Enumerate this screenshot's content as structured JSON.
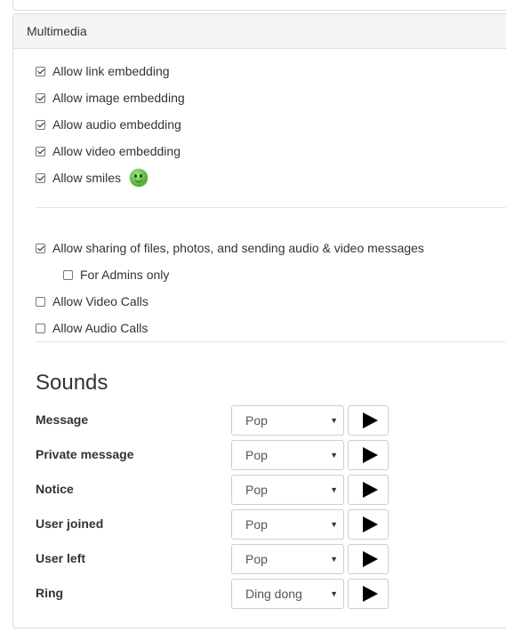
{
  "panel": {
    "title": "Multimedia"
  },
  "embedding": [
    {
      "label": "Allow link embedding",
      "checked": true
    },
    {
      "label": "Allow image embedding",
      "checked": true
    },
    {
      "label": "Allow audio embedding",
      "checked": true
    },
    {
      "label": "Allow video embedding",
      "checked": true
    },
    {
      "label": "Allow smiles",
      "checked": true,
      "icon": "smile-icon"
    }
  ],
  "sharing": [
    {
      "label": "Allow sharing of files, photos, and sending audio & video messages",
      "checked": true
    },
    {
      "label": "For Admins only",
      "checked": false
    },
    {
      "label": "Allow Video Calls",
      "checked": false
    },
    {
      "label": "Allow Audio Calls",
      "checked": false
    }
  ],
  "sounds": {
    "title": "Sounds",
    "rows": [
      {
        "label": "Message",
        "value": "Pop"
      },
      {
        "label": "Private message",
        "value": "Pop"
      },
      {
        "label": "Notice",
        "value": "Pop"
      },
      {
        "label": "User joined",
        "value": "Pop"
      },
      {
        "label": "User left",
        "value": "Pop"
      },
      {
        "label": "Ring",
        "value": "Ding dong"
      }
    ],
    "play_icon": "play-icon"
  }
}
